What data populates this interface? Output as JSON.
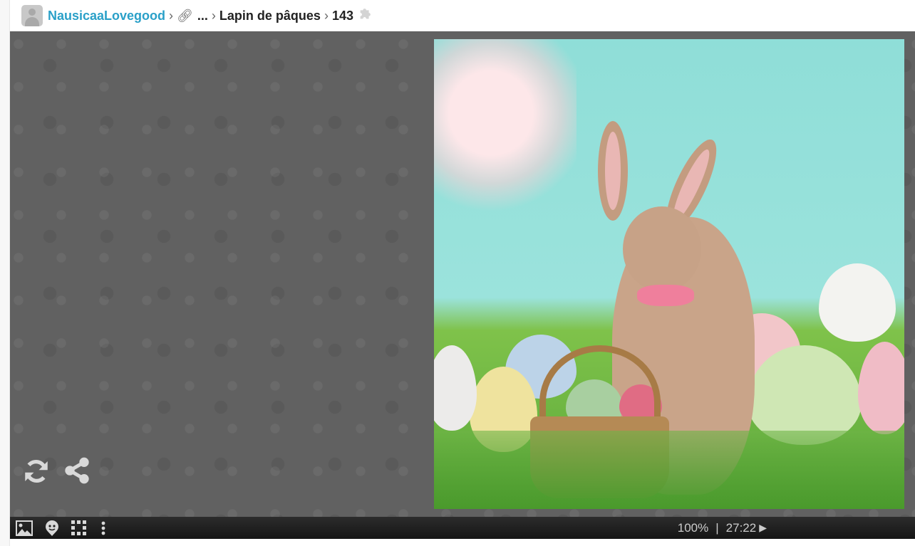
{
  "header": {
    "user": "NausicaaLovegood",
    "ellipsis": "...",
    "puzzle_title": "Lapin de pâques",
    "piece_count": "143"
  },
  "toolbar": {
    "zoom": "100%",
    "divider": "|",
    "timer": "27:22"
  },
  "icons": [
    "image-icon",
    "ghost-icon",
    "grid-icon",
    "more-icon",
    "refresh-icon",
    "share-icon",
    "play-icon",
    "link-icon",
    "puzzle-icon"
  ]
}
